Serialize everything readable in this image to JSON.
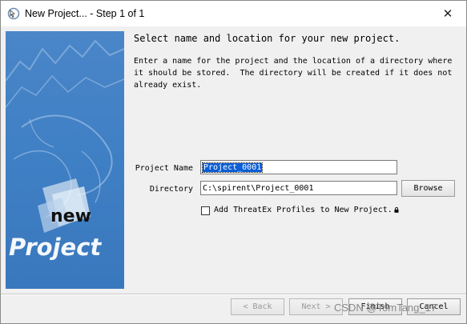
{
  "window": {
    "title": "New Project... - Step 1 of 1",
    "close_glyph": "✕"
  },
  "banner": {
    "word_new": "new",
    "word_project": "Project",
    "bg_color": "#3f7fc4"
  },
  "main": {
    "heading": "Select name and location for your new project.",
    "description": "Enter a name for the project and the location of a directory where\nit should be stored.  The directory will be created if it does not\nalready exist."
  },
  "form": {
    "project_name_label": "Project Name",
    "project_name_value": "Project_0001",
    "directory_label": "Directory",
    "directory_value": "C:\\spirent\\Project_0001",
    "browse_label": "Browse",
    "threatex_checkbox_label": "Add ThreatEx Profiles to New Project.",
    "threatex_checked": false
  },
  "footer": {
    "back_label": "< Back",
    "next_label": "Next >",
    "finish_label": "Finish",
    "cancel_label": "Cancel",
    "watermark": "CSDN @TomTang_17"
  },
  "icons": {
    "title_icon": "wizard-cursor-icon",
    "close": "close-icon",
    "lock": "lock-icon"
  }
}
